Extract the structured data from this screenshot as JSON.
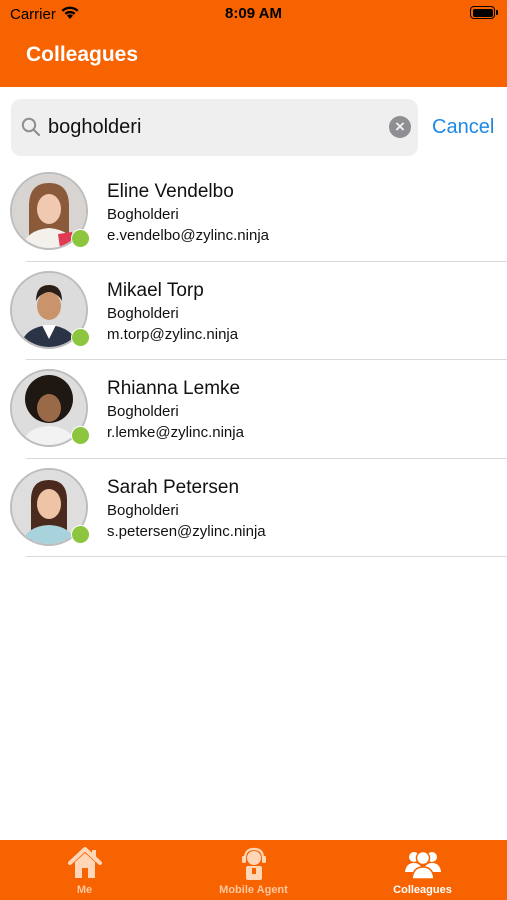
{
  "status_bar": {
    "carrier": "Carrier",
    "time": "8:09 AM"
  },
  "header": {
    "title": "Colleagues"
  },
  "search": {
    "value": "bogholderi",
    "cancel_label": "Cancel"
  },
  "contacts": [
    {
      "name": "Eline Vendelbo",
      "department": "Bogholderi",
      "email": "e.vendelbo@zylinc.ninja"
    },
    {
      "name": "Mikael Torp",
      "department": "Bogholderi",
      "email": "m.torp@zylinc.ninja"
    },
    {
      "name": "Rhianna Lemke",
      "department": "Bogholderi",
      "email": "r.lemke@zylinc.ninja"
    },
    {
      "name": "Sarah Petersen",
      "department": "Bogholderi",
      "email": "s.petersen@zylinc.ninja"
    }
  ],
  "tabs": [
    {
      "label": "Me",
      "icon": "house-icon"
    },
    {
      "label": "Mobile Agent",
      "icon": "agent-icon"
    },
    {
      "label": "Colleagues",
      "icon": "colleagues-icon"
    }
  ],
  "colors": {
    "brand": "#F76300",
    "presence": "#8CC63F",
    "link": "#1E88E5"
  }
}
